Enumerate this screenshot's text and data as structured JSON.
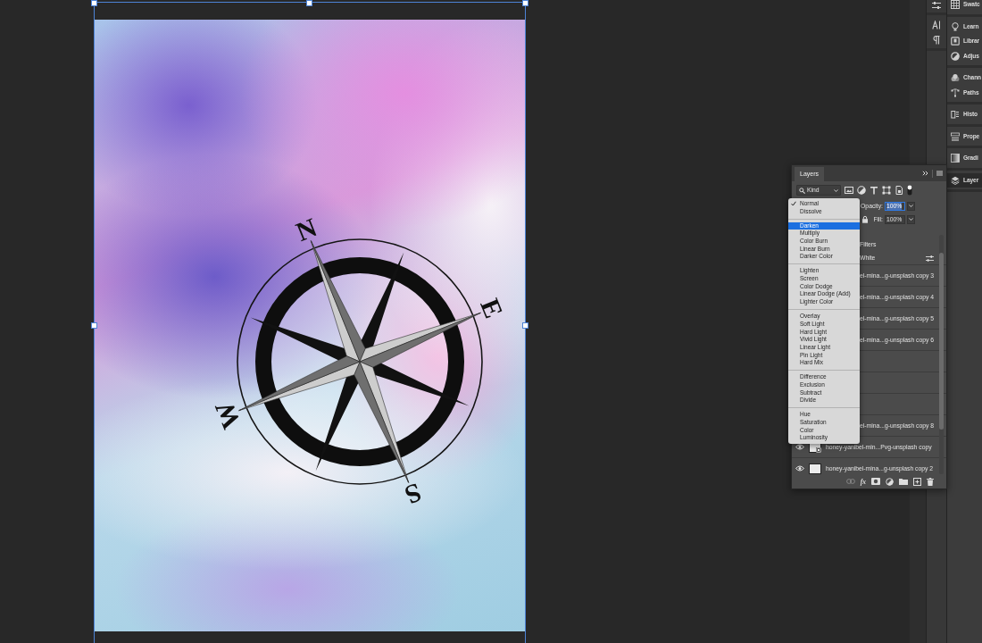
{
  "document": {
    "compass_labels": [
      "N",
      "E",
      "S",
      "W"
    ]
  },
  "layers_panel": {
    "title": "Layers",
    "filter": {
      "value": "Kind",
      "filtering_on": true
    },
    "opacity": {
      "label": "Opacity:",
      "value": "100%",
      "focused": true
    },
    "fill": {
      "label": "Fill:",
      "value": "100%"
    },
    "rows": [
      {
        "kind": "smart-filters",
        "name": "Filters"
      },
      {
        "kind": "filter",
        "name": "White"
      },
      {
        "kind": "covered",
        "name": "el-mina...g-unsplash copy 3"
      },
      {
        "kind": "covered",
        "name": "el-mina...g-unsplash copy 4"
      },
      {
        "kind": "covered",
        "name": "el-mina...g-unsplash copy 5"
      },
      {
        "kind": "covered",
        "name": "el-mina...g-unsplash copy 6"
      },
      {
        "kind": "covered"
      },
      {
        "kind": "covered"
      },
      {
        "kind": "covered"
      },
      {
        "kind": "covered",
        "name": "el-mina...g-unsplash copy 8"
      },
      {
        "kind": "layer",
        "name": "honey-yanibel-min...Pvg-unsplash copy",
        "visible": true,
        "smart_object": true
      },
      {
        "kind": "layer",
        "name": "honey-yanibel-mina...g-unsplash copy 2",
        "visible": true,
        "smart_object": false
      }
    ],
    "style_button": "fx"
  },
  "blend_menu": {
    "groups": [
      {
        "items": [
          {
            "label": "Normal",
            "checked": true,
            "highlighted": false
          },
          {
            "label": "Dissolve",
            "checked": false,
            "highlighted": false
          }
        ]
      },
      {
        "items": [
          {
            "label": "Darken",
            "checked": false,
            "highlighted": true
          },
          {
            "label": "Multiply",
            "checked": false,
            "highlighted": false
          },
          {
            "label": "Color Burn",
            "checked": false,
            "highlighted": false
          },
          {
            "label": "Linear Burn",
            "checked": false,
            "highlighted": false
          },
          {
            "label": "Darker Color",
            "checked": false,
            "highlighted": false
          }
        ]
      },
      {
        "items": [
          {
            "label": "Lighten",
            "checked": false,
            "highlighted": false
          },
          {
            "label": "Screen",
            "checked": false,
            "highlighted": false
          },
          {
            "label": "Color Dodge",
            "checked": false,
            "highlighted": false
          },
          {
            "label": "Linear Dodge (Add)",
            "checked": false,
            "highlighted": false
          },
          {
            "label": "Lighter Color",
            "checked": false,
            "highlighted": false
          }
        ]
      },
      {
        "items": [
          {
            "label": "Overlay",
            "checked": false,
            "highlighted": false
          },
          {
            "label": "Soft Light",
            "checked": false,
            "highlighted": false
          },
          {
            "label": "Hard Light",
            "checked": false,
            "highlighted": false
          },
          {
            "label": "Vivid Light",
            "checked": false,
            "highlighted": false
          },
          {
            "label": "Linear Light",
            "checked": false,
            "highlighted": false
          },
          {
            "label": "Pin Light",
            "checked": false,
            "highlighted": false
          },
          {
            "label": "Hard Mix",
            "checked": false,
            "highlighted": false
          }
        ]
      },
      {
        "items": [
          {
            "label": "Difference",
            "checked": false,
            "highlighted": false
          },
          {
            "label": "Exclusion",
            "checked": false,
            "highlighted": false
          },
          {
            "label": "Subtract",
            "checked": false,
            "highlighted": false
          },
          {
            "label": "Divide",
            "checked": false,
            "highlighted": false
          }
        ]
      },
      {
        "items": [
          {
            "label": "Hue",
            "checked": false,
            "highlighted": false
          },
          {
            "label": "Saturation",
            "checked": false,
            "highlighted": false
          },
          {
            "label": "Color",
            "checked": false,
            "highlighted": false
          },
          {
            "label": "Luminosity",
            "checked": false,
            "highlighted": false
          }
        ]
      }
    ]
  },
  "panel_dock": {
    "groups": [
      {
        "items": [
          {
            "label": "Swatc",
            "selected": false
          }
        ]
      },
      {
        "items": [
          {
            "label": "Learn",
            "selected": false
          },
          {
            "label": "Librar",
            "selected": false
          },
          {
            "label": "Adjus",
            "selected": false
          }
        ]
      },
      {
        "items": [
          {
            "label": "Chann",
            "selected": false
          },
          {
            "label": "Paths",
            "selected": false
          }
        ]
      },
      {
        "items": [
          {
            "label": "Histo",
            "selected": false
          }
        ]
      },
      {
        "items": [
          {
            "label": "Prope",
            "selected": false
          }
        ]
      },
      {
        "items": [
          {
            "label": "Gradi",
            "selected": false
          }
        ]
      },
      {
        "items": [
          {
            "label": "Layer",
            "selected": true
          }
        ]
      }
    ]
  }
}
